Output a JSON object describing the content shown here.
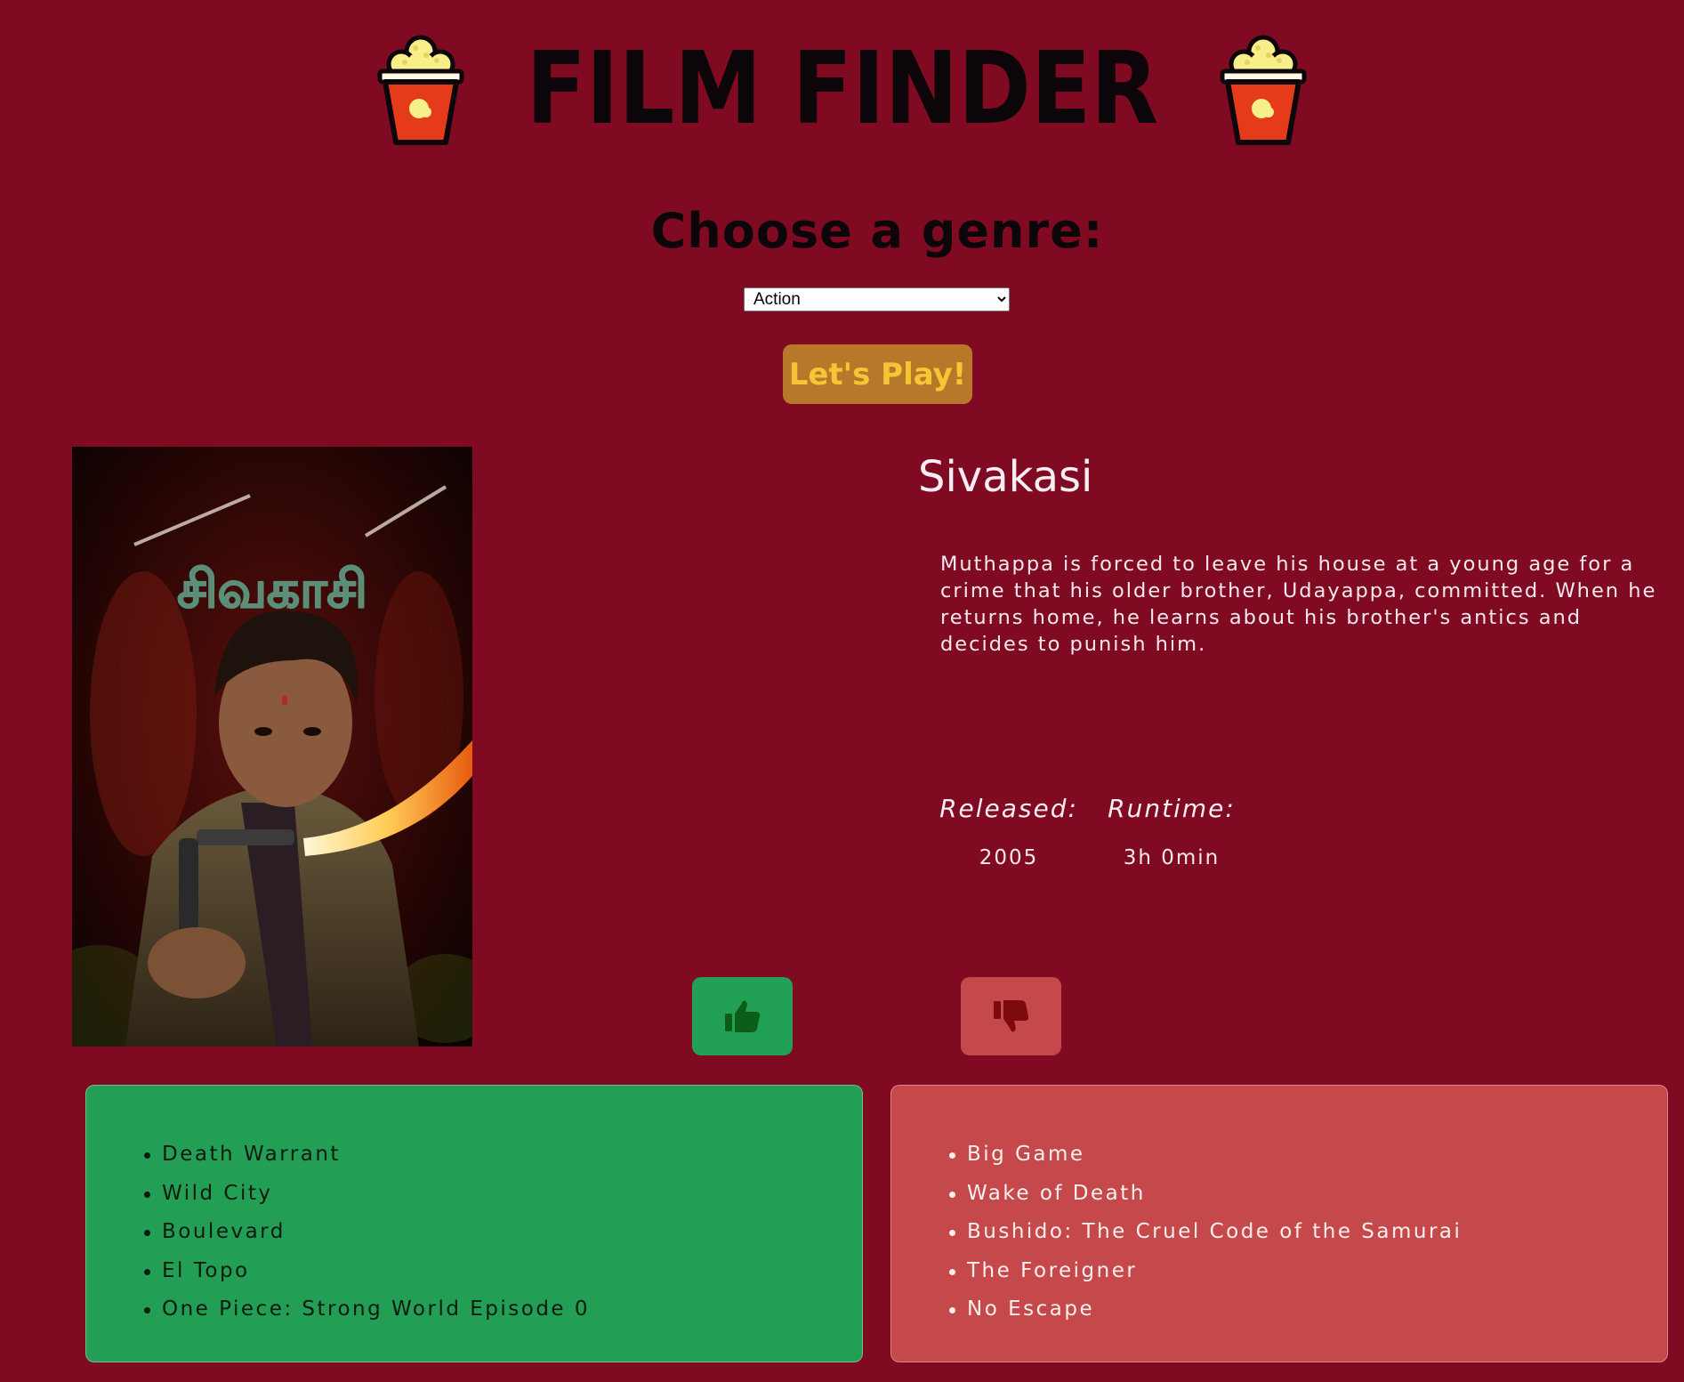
{
  "header": {
    "title": "FILM FINDER",
    "icon": "popcorn-icon"
  },
  "genre": {
    "heading": "Choose a genre:",
    "selected": "Action"
  },
  "play_button": {
    "label": "Let's Play!"
  },
  "movie": {
    "title": "Sivakasi",
    "overview": "Muthappa is forced to leave his house at a young age for a crime that his older brother, Udayappa, committed. When he returns home, he learns about his brother's antics and decides to punish him.",
    "poster_title_script": "சிவகாசி",
    "released_label": "Released:",
    "released_value": "2005",
    "runtime_label": "Runtime:",
    "runtime_value": "3h 0min"
  },
  "vote": {
    "like_icon": "thumbs-up-icon",
    "dislike_icon": "thumbs-down-icon"
  },
  "liked_movies": [
    "Death Warrant",
    "Wild City",
    "Boulevard",
    "El Topo",
    "One Piece: Strong World Episode 0"
  ],
  "disliked_movies": [
    "Big Game",
    "Wake of Death",
    "Bushido: The Cruel Code of the Samurai",
    "The Foreigner",
    "No Escape"
  ],
  "colors": {
    "background": "#800a22",
    "like_green": "#22a055",
    "dislike_red": "#c5494a",
    "play_button": "#b8782a",
    "play_text": "#f6c536"
  }
}
